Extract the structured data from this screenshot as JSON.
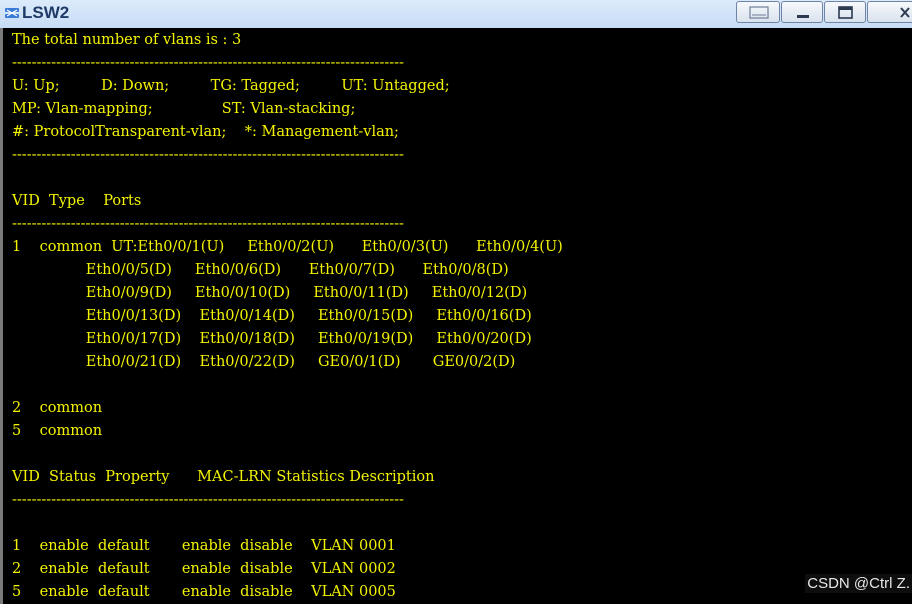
{
  "window": {
    "title": "LSW2",
    "icon": "network-switch-icon",
    "controls": [
      "keyboard",
      "minimize",
      "maximize",
      "close"
    ]
  },
  "terminal": {
    "text_color": "#f4f400",
    "background": "#000000",
    "lines": [
      "The total number of vlans is : 3",
      "--------------------------------------------------------------------------------",
      "U: Up;         D: Down;         TG: Tagged;         UT: Untagged;",
      "MP: Vlan-mapping;               ST: Vlan-stacking;",
      "#: ProtocolTransparent-vlan;    *: Management-vlan;",
      "--------------------------------------------------------------------------------",
      "",
      "VID  Type    Ports",
      "--------------------------------------------------------------------------------",
      "1    common  UT:Eth0/0/1(U)     Eth0/0/2(U)      Eth0/0/3(U)      Eth0/0/4(U)",
      "                Eth0/0/5(D)     Eth0/0/6(D)      Eth0/0/7(D)      Eth0/0/8(D)",
      "                Eth0/0/9(D)     Eth0/0/10(D)     Eth0/0/11(D)     Eth0/0/12(D)",
      "                Eth0/0/13(D)    Eth0/0/14(D)     Eth0/0/15(D)     Eth0/0/16(D)",
      "                Eth0/0/17(D)    Eth0/0/18(D)     Eth0/0/19(D)     Eth0/0/20(D)",
      "                Eth0/0/21(D)    Eth0/0/22(D)     GE0/0/1(D)       GE0/0/2(D)",
      "",
      "2    common",
      "5    common",
      "",
      "VID  Status  Property      MAC-LRN Statistics Description",
      "--------------------------------------------------------------------------------",
      "",
      "1    enable  default       enable  disable    VLAN 0001",
      "2    enable  default       enable  disable    VLAN 0002",
      "5    enable  default       enable  disable    VLAN 0005"
    ]
  },
  "watermark": "CSDN @Ctrl Z."
}
